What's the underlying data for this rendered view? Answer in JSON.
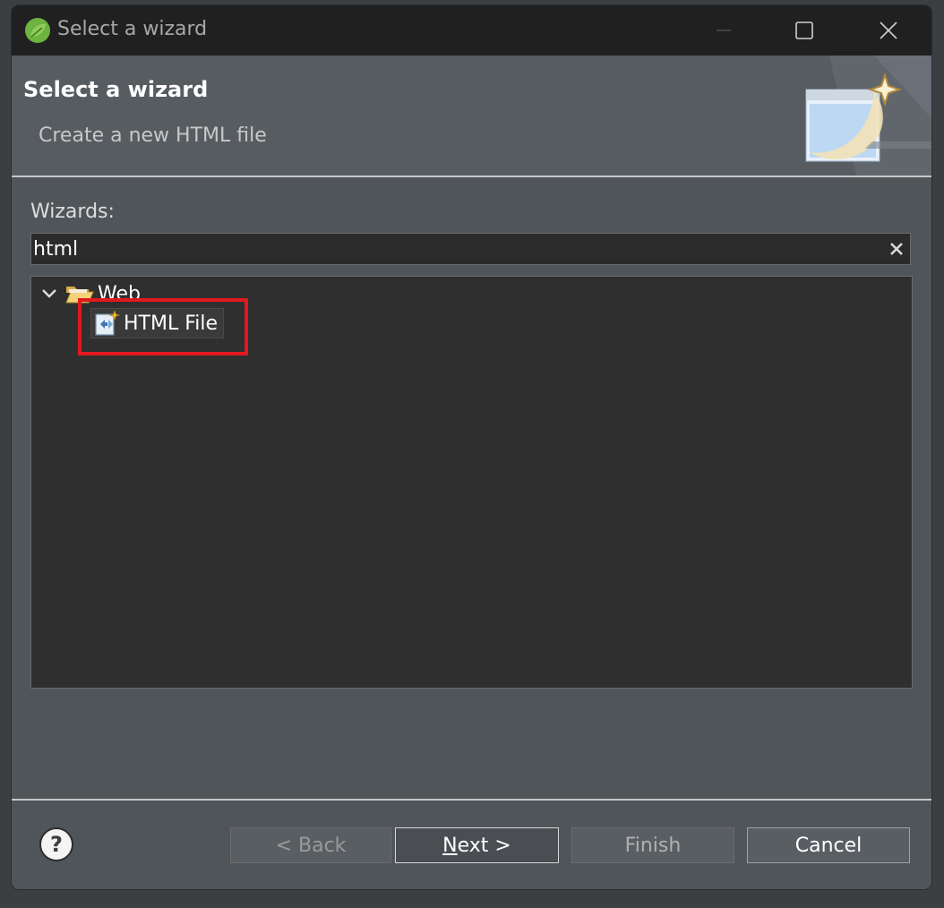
{
  "window": {
    "title": "Select a wizard"
  },
  "banner": {
    "heading": "Select a wizard",
    "description": "Create a new HTML file"
  },
  "wizards": {
    "label": "Wizards:",
    "filter_value": "html",
    "tree": [
      {
        "label": "Web",
        "icon": "folder-open-icon",
        "expanded": true,
        "children": [
          {
            "label": "HTML File",
            "icon": "html-file-icon",
            "selected": true
          }
        ]
      }
    ]
  },
  "buttons": {
    "back": "< Back",
    "next_mnemonic": "N",
    "next_rest": "ext >",
    "finish": "Finish",
    "cancel": "Cancel"
  },
  "colors": {
    "highlight": "#e0191f",
    "title_bar": "#202020",
    "dialog_bg": "#50555a"
  }
}
